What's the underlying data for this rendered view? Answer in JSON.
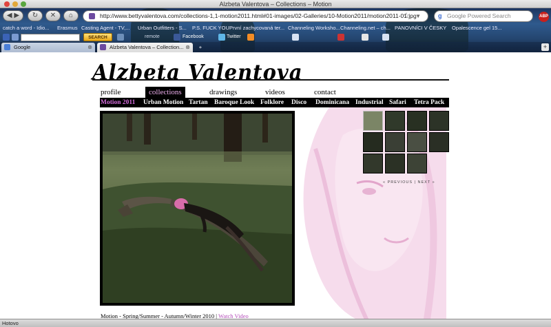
{
  "window": {
    "title": "Alzbeta Valentova – Collections – Motion"
  },
  "browser": {
    "url": "http://www.bettyvalentova.com/collections-1,1-motion2011.html#01-images/02-Galleries/10-Motion2011/motion2011-01.jpg",
    "search_placeholder": "Google Powered Search",
    "adblock_label": "ABP",
    "bookmarks": [
      "catch a word - Idio...",
      "Erasmus",
      "Casting Agent - TV,...",
      "Urban Outfitters - S...",
      "P.S. FUCK YOU",
      "První zachycovaná ter...",
      "Channeling Worksho...",
      "Channeling.net – ch...",
      "PANOVNÍCI V ČESKY",
      "Opalescence gel 15..."
    ],
    "toolbar": {
      "search_button": "SEARCH",
      "remote_label": "remote",
      "facebook_label": "Facebook",
      "twitter_label": "Twitter"
    },
    "tabs": [
      {
        "label": "Google",
        "active": false
      },
      {
        "label": "Alzbeta Valentova – Collection...",
        "active": true
      }
    ],
    "status": "Hotovo"
  },
  "site": {
    "logo": "Alzbeta Valentova",
    "menu": [
      "profile",
      "collections",
      "drawings",
      "videos",
      "contact"
    ],
    "active_menu": "collections",
    "submenu": [
      "Motion 2011",
      "Urban Motion",
      "Tartan",
      "Baroque Look",
      "Folklore",
      "Disco",
      "Dominicana",
      "Industrial",
      "Safari",
      "Tetra Pack"
    ],
    "active_submenu": "Motion 2011",
    "thumbnail_count": 11,
    "selected_thumbnail": 1,
    "pager": {
      "previous": "« PREVIOUS",
      "separator": "|",
      "next": "NEXT »"
    },
    "caption": {
      "text": "Motion - Spring/Summer - Autumn/Winter 2010 |",
      "link": "Watch Video"
    }
  }
}
